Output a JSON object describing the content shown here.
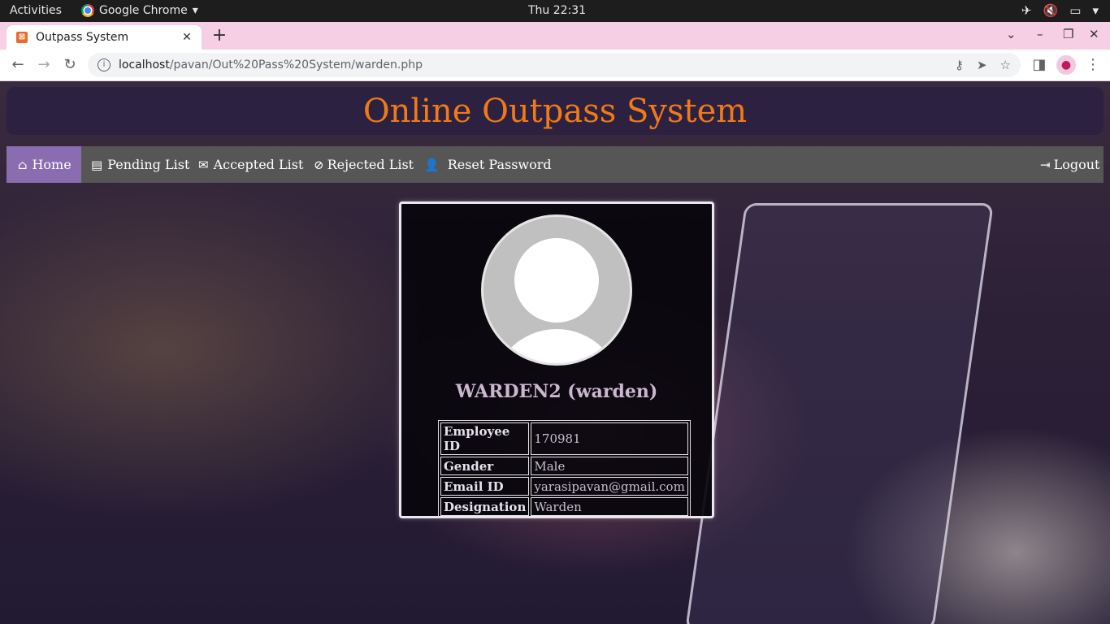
{
  "system_bar": {
    "activities": "Activities",
    "app_name": "Google Chrome",
    "clock": "Thu 22:31"
  },
  "browser": {
    "tab_title": "Outpass System",
    "url_host": "localhost",
    "url_path": "/pavan/Out%20Pass%20System/warden.php"
  },
  "header": {
    "title": "Online Outpass System"
  },
  "nav": {
    "home": "Home",
    "pending": "Pending List",
    "accepted": "Accepted List",
    "rejected": "Rejected List",
    "reset": "Reset Password",
    "logout": "Logout"
  },
  "profile": {
    "name": "WARDEN2 (warden)",
    "rows": [
      {
        "label": "Employee ID",
        "value": "170981"
      },
      {
        "label": "Gender",
        "value": "Male"
      },
      {
        "label": "Email ID",
        "value": "yarasipavan@gmail.com"
      },
      {
        "label": "Designation",
        "value": "Warden"
      }
    ]
  },
  "colors": {
    "title": "#f07a17",
    "nav_active": "#8a6db0",
    "nav_bg": "#565656",
    "header_bg": "#2c2140"
  }
}
